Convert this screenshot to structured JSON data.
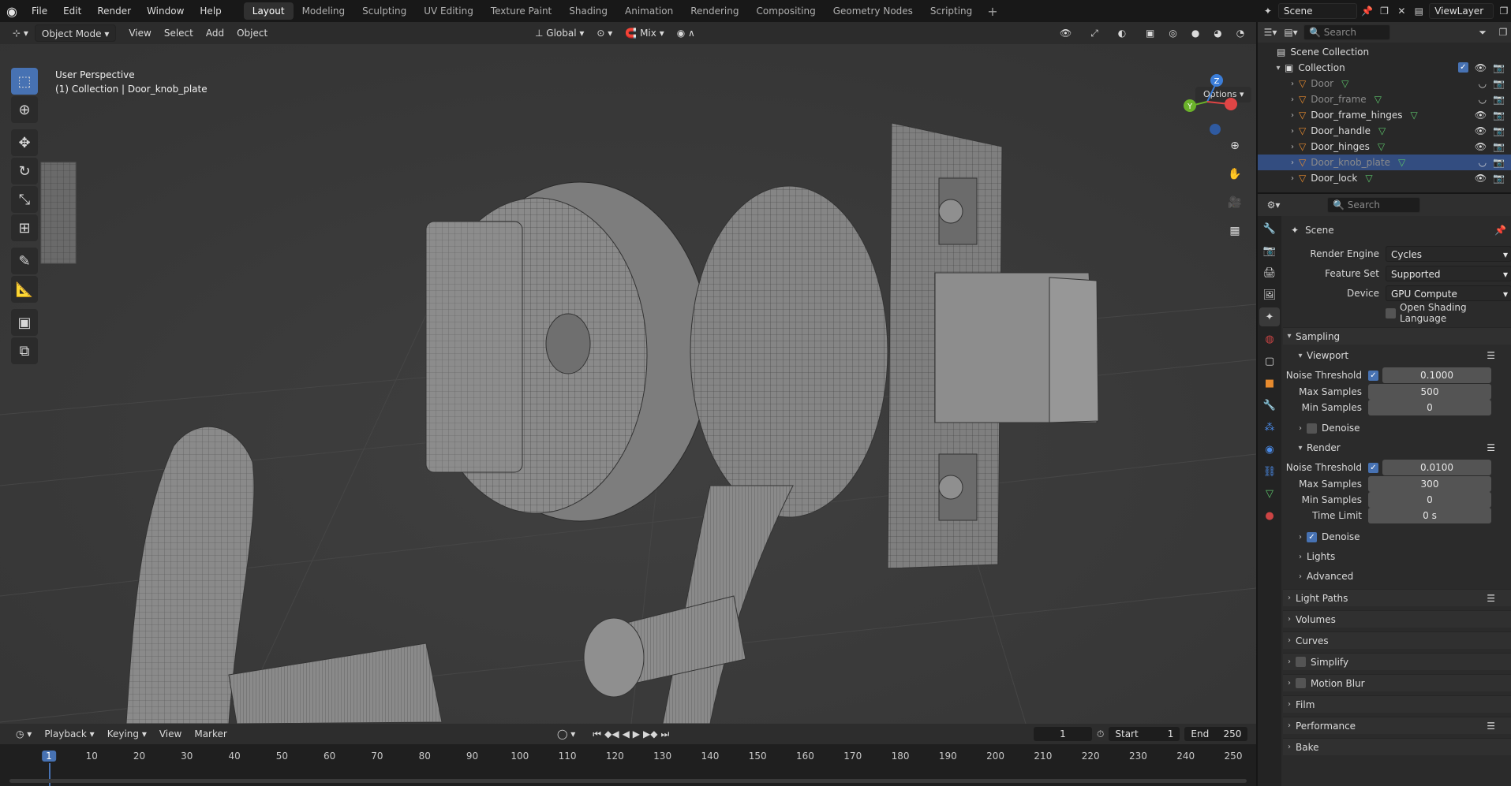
{
  "menu": [
    "File",
    "Edit",
    "Render",
    "Window",
    "Help"
  ],
  "workspaces": [
    "Layout",
    "Modeling",
    "Sculpting",
    "UV Editing",
    "Texture Paint",
    "Shading",
    "Animation",
    "Rendering",
    "Compositing",
    "Geometry Nodes",
    "Scripting"
  ],
  "active_workspace": "Layout",
  "scene_name": "Scene",
  "view_layer": "ViewLayer",
  "viewport_header": {
    "mode": "Object Mode",
    "menus": [
      "View",
      "Select",
      "Add",
      "Object"
    ],
    "orientation": "Global",
    "snap": "Mix",
    "options": "Options"
  },
  "viewport_info": {
    "line1": "User Perspective",
    "line2": "(1) Collection | Door_knob_plate"
  },
  "gizmo": {
    "z": "Z",
    "y": "Y"
  },
  "timeline": {
    "menus": [
      "Playback",
      "Keying",
      "View",
      "Marker"
    ],
    "current_frame": "1",
    "start_label": "Start",
    "start": "1",
    "end_label": "End",
    "end": "250",
    "ticks": [
      "1",
      "10",
      "20",
      "30",
      "40",
      "50",
      "60",
      "70",
      "80",
      "90",
      "100",
      "110",
      "120",
      "130",
      "140",
      "150",
      "160",
      "170",
      "180",
      "190",
      "200",
      "210",
      "220",
      "230",
      "240",
      "250"
    ]
  },
  "outliner": {
    "search_placeholder": "Search",
    "scene_collection": "Scene Collection",
    "collection": "Collection",
    "objects": [
      {
        "name": "Door",
        "dim": true
      },
      {
        "name": "Door_frame",
        "dim": true
      },
      {
        "name": "Door_frame_hinges",
        "dim": false
      },
      {
        "name": "Door_handle",
        "dim": false
      },
      {
        "name": "Door_hinges",
        "dim": false
      },
      {
        "name": "Door_knob_plate",
        "dim": true,
        "selected": true
      },
      {
        "name": "Door_lock",
        "dim": false
      }
    ]
  },
  "properties": {
    "search_placeholder": "Search",
    "context": "Scene",
    "render_engine_label": "Render Engine",
    "render_engine": "Cycles",
    "feature_set_label": "Feature Set",
    "feature_set": "Supported",
    "device_label": "Device",
    "device": "GPU Compute",
    "osl_label": "Open Shading Language",
    "sampling": "Sampling",
    "viewport": "Viewport",
    "noise_threshold_label": "Noise Threshold",
    "viewport_noise": "0.1000",
    "max_samples_label": "Max Samples",
    "viewport_max": "500",
    "min_samples_label": "Min Samples",
    "viewport_min": "0",
    "denoise_label": "Denoise",
    "render": "Render",
    "render_noise": "0.0100",
    "render_max": "300",
    "render_min": "0",
    "time_limit_label": "Time Limit",
    "time_limit": "0 s",
    "lights": "Lights",
    "advanced": "Advanced",
    "light_paths": "Light Paths",
    "volumes": "Volumes",
    "curves": "Curves",
    "simplify": "Simplify",
    "motion_blur": "Motion Blur",
    "film": "Film",
    "performance": "Performance",
    "bake": "Bake"
  }
}
